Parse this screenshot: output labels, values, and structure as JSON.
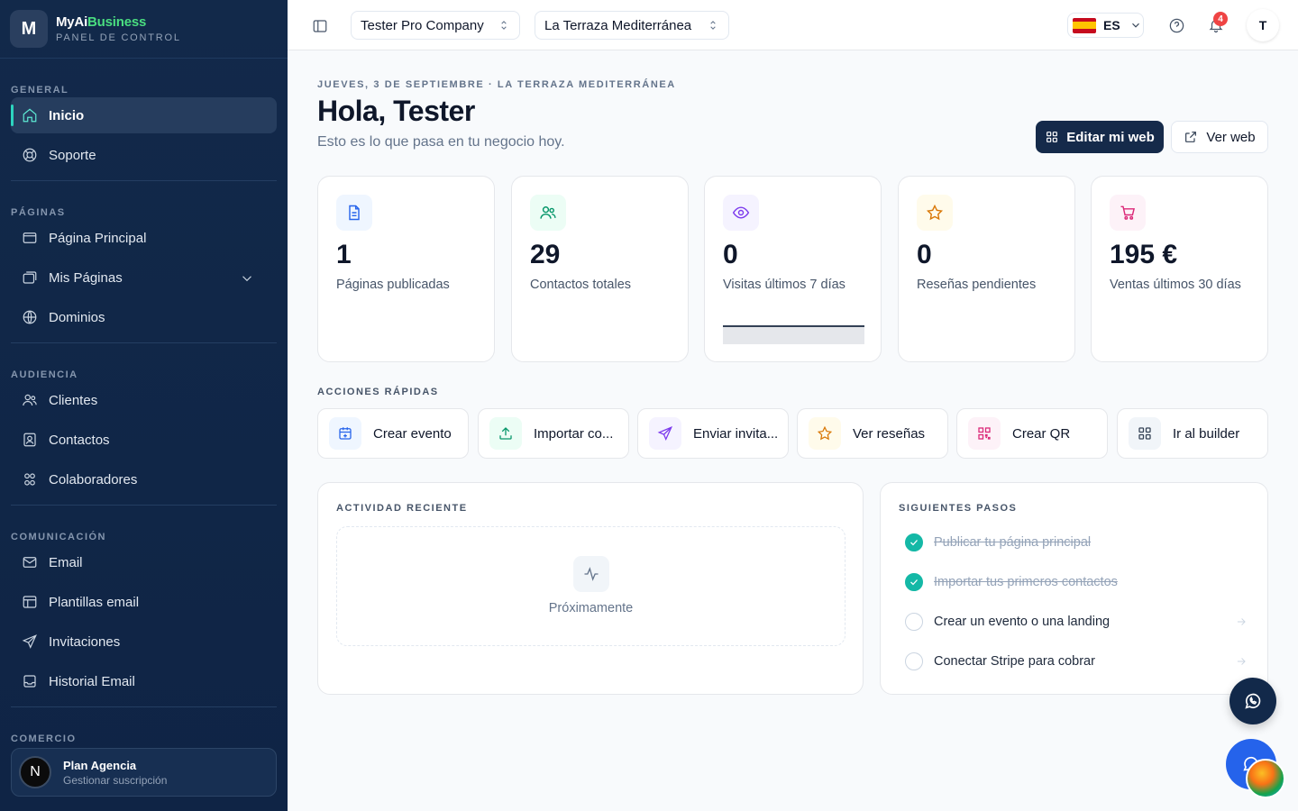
{
  "brand": {
    "name_part1": "MyAi",
    "name_part2": "Business",
    "subtitle": "PANEL DE CONTROL",
    "logo_letter": "M"
  },
  "sidebar": {
    "sections": [
      {
        "title": "GENERAL",
        "items": [
          {
            "label": "Inicio",
            "icon": "home-icon",
            "active": true
          },
          {
            "label": "Soporte",
            "icon": "lifebuoy-icon"
          }
        ]
      },
      {
        "title": "PÁGINAS",
        "items": [
          {
            "label": "Página Principal",
            "icon": "window-icon"
          },
          {
            "label": "Mis Páginas",
            "icon": "pages-icon",
            "expandable": true
          },
          {
            "label": "Dominios",
            "icon": "globe-icon"
          }
        ]
      },
      {
        "title": "AUDIENCIA",
        "items": [
          {
            "label": "Clientes",
            "icon": "users-icon"
          },
          {
            "label": "Contactos",
            "icon": "contact-icon"
          },
          {
            "label": "Colaboradores",
            "icon": "team-icon"
          }
        ]
      },
      {
        "title": "COMUNICACIÓN",
        "items": [
          {
            "label": "Email",
            "icon": "mail-icon"
          },
          {
            "label": "Plantillas email",
            "icon": "template-icon"
          },
          {
            "label": "Invitaciones",
            "icon": "send-icon"
          },
          {
            "label": "Historial Email",
            "icon": "inbox-icon"
          }
        ]
      },
      {
        "title": "COMERCIO",
        "items": []
      }
    ],
    "plan": {
      "avatar_letter": "N",
      "name": "Plan Agencia",
      "subtitle": "Gestionar suscripción"
    }
  },
  "topbar": {
    "company_selector": "Tester Pro Company",
    "business_selector": "La Terraza Mediterránea",
    "language": "ES",
    "notification_count": "4",
    "user_initial": "T"
  },
  "main": {
    "date_line": "JUEVES, 3 DE SEPTIEMBRE · LA TERRAZA MEDITERRÁNEA",
    "greeting": "Hola, Tester",
    "subtitle": "Esto es lo que pasa en tu negocio hoy.",
    "edit_button": "Editar mi web",
    "view_button": "Ver web",
    "stats": [
      {
        "value": "1",
        "label": "Páginas publicadas",
        "icon": "document-icon",
        "color": "#2563eb",
        "bg": "#eff6ff"
      },
      {
        "value": "29",
        "label": "Contactos totales",
        "icon": "users-icon",
        "color": "#059669",
        "bg": "#ecfdf5"
      },
      {
        "value": "0",
        "label": "Visitas últimos 7 días",
        "icon": "eye-icon",
        "color": "#7c3aed",
        "bg": "#f5f3ff"
      },
      {
        "value": "0",
        "label": "Reseñas pendientes",
        "icon": "star-icon",
        "color": "#d97706",
        "bg": "#fffbeb"
      },
      {
        "value": "195 €",
        "label": "Ventas últimos 30 días",
        "icon": "cart-icon",
        "color": "#db2777",
        "bg": "#fdf2f8"
      }
    ],
    "quick_actions_title": "ACCIONES RÁPIDAS",
    "quick_actions": [
      {
        "label": "Crear evento",
        "icon": "calendar-plus-icon",
        "color": "#2563eb",
        "bg": "#eff6ff"
      },
      {
        "label": "Importar co...",
        "icon": "upload-icon",
        "color": "#059669",
        "bg": "#ecfdf5"
      },
      {
        "label": "Enviar invita...",
        "icon": "send-icon",
        "color": "#7c3aed",
        "bg": "#f5f3ff"
      },
      {
        "label": "Ver reseñas",
        "icon": "star-icon",
        "color": "#d97706",
        "bg": "#fffbeb"
      },
      {
        "label": "Crear QR",
        "icon": "qr-icon",
        "color": "#db2777",
        "bg": "#fdf2f8"
      },
      {
        "label": "Ir al builder",
        "icon": "grid-icon",
        "color": "#334155",
        "bg": "#f1f5f9"
      }
    ],
    "activity": {
      "title": "ACTIVIDAD RECIENTE",
      "empty_text": "Próximamente"
    },
    "next_steps": {
      "title": "SIGUIENTES PASOS",
      "items": [
        {
          "label": "Publicar tu página principal",
          "done": true
        },
        {
          "label": "Importar tus primeros contactos",
          "done": true
        },
        {
          "label": "Crear un evento o una landing",
          "done": false
        },
        {
          "label": "Conectar Stripe para cobrar",
          "done": false
        }
      ]
    }
  },
  "colors": {
    "sidebar_bg": "#12294a",
    "accent": "#14b8a6",
    "primary_button": "#152a4a"
  }
}
